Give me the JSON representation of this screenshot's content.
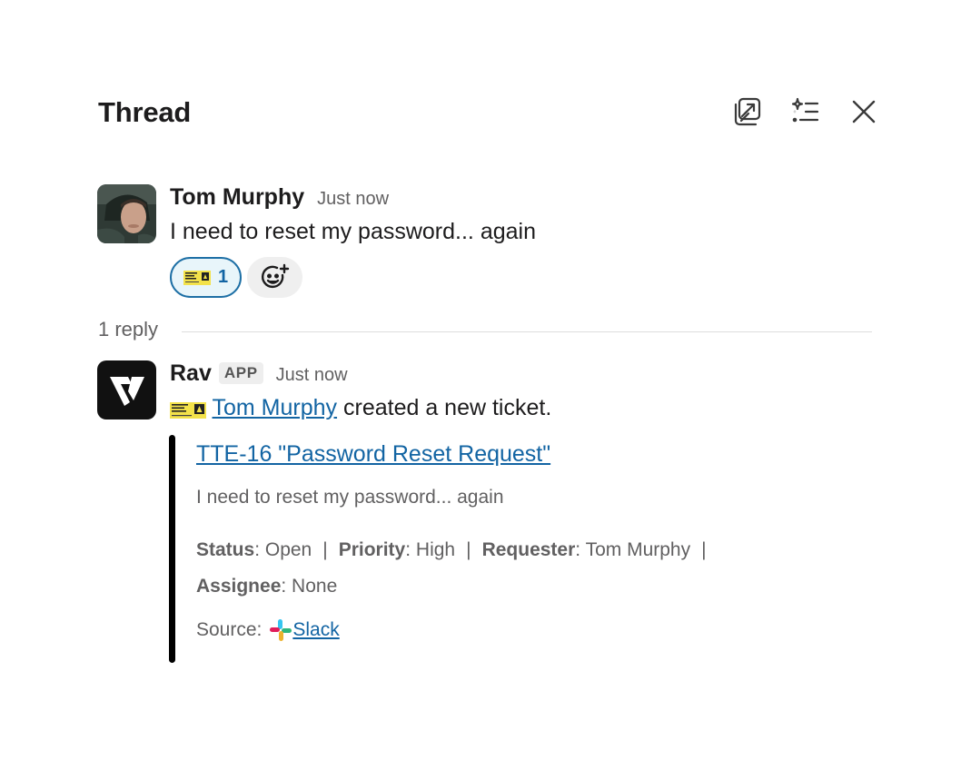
{
  "header": {
    "title": "Thread",
    "open_in_window_icon": "external-window-icon",
    "ai_summary_icon": "sparkle-list-icon",
    "close_icon": "close-icon"
  },
  "parent_message": {
    "author": "Tom Murphy",
    "timestamp": "Just now",
    "text": "I need to reset my password... again",
    "reaction": {
      "emoji": "live-concert-ticket-emoji",
      "count": "1"
    },
    "add_reaction_icon": "add-reaction-icon"
  },
  "replies": {
    "count_label": "1 reply"
  },
  "reply_message": {
    "author": "Rav",
    "badge": "APP",
    "timestamp": "Just now",
    "mention": "Tom Murphy",
    "text_suffix": " created a new ticket.",
    "attachment": {
      "title": "TTE-16 \"Password Reset Request\"",
      "description": "I need to reset my password... again",
      "fields": [
        {
          "label": "Status",
          "value": "Open"
        },
        {
          "label": "Priority",
          "value": "High"
        },
        {
          "label": "Requester",
          "value": "Tom Murphy"
        },
        {
          "label": "Assignee",
          "value": "None"
        }
      ],
      "source_label": "Source:",
      "source_link": " Slack",
      "source_icon": "slack-icon"
    }
  },
  "colors": {
    "link": "#1264a3",
    "reaction_border": "#1d6fa5",
    "reaction_bg": "#e8f5fa",
    "attachment_bar": "#000000",
    "muted_text": "#616061"
  }
}
